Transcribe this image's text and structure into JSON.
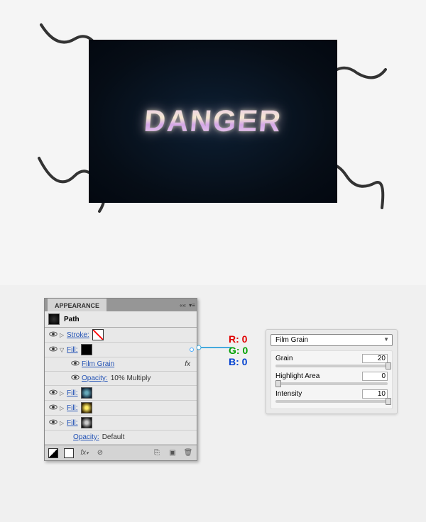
{
  "artwork_text": "DANGER",
  "appearance": {
    "title": "APPEARANCE",
    "target": "Path",
    "rows": [
      {
        "eye": true,
        "tri": "▷",
        "label": "Stroke:",
        "swatch": "none",
        "link": true
      },
      {
        "eye": true,
        "tri": "▽",
        "label": "Fill:",
        "swatch": "black",
        "link": true,
        "ring": true
      },
      {
        "eye": true,
        "indent": 2,
        "label": "Film Grain",
        "link": true,
        "fx": true
      },
      {
        "eye": true,
        "indent": 2,
        "label": "Opacity:",
        "val": "10% Multiply",
        "link": true
      },
      {
        "eye": true,
        "tri": "▷",
        "label": "Fill:",
        "swatch": "rad-blue",
        "link": true
      },
      {
        "eye": true,
        "tri": "▷",
        "label": "Fill:",
        "swatch": "rad-gold",
        "link": true
      },
      {
        "eye": true,
        "tri": "▷",
        "label": "Fill:",
        "swatch": "rad-gray",
        "link": true
      },
      {
        "eye": false,
        "indent": 1,
        "label": "Opacity:",
        "val": "Default",
        "link": true
      }
    ]
  },
  "rgb": {
    "r": "R: 0",
    "g": "G: 0",
    "b": "B: 0"
  },
  "effect": {
    "name": "Film Grain",
    "sliders": [
      {
        "label": "Grain",
        "value": "20",
        "pos": 98
      },
      {
        "label": "Highlight Area",
        "value": "0",
        "pos": 0
      },
      {
        "label": "Intensity",
        "value": "10",
        "pos": 98
      }
    ]
  }
}
